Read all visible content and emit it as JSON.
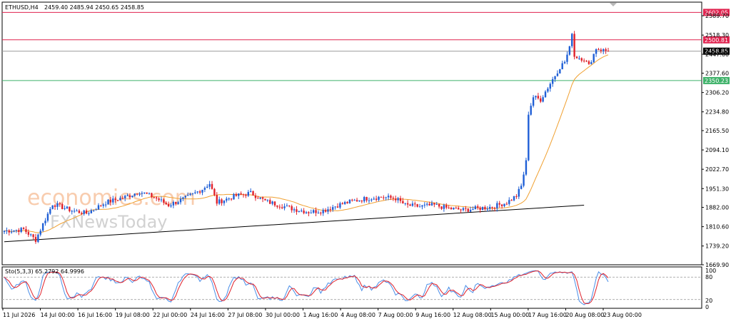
{
  "header": {
    "symbol": "ETHUSD,H4",
    "ohlc": "2459.40 2485.94 2450.65 2458.85"
  },
  "oscillator": {
    "label": "Sto(5,3,3) 65.2792 64.9996",
    "k": 65.2792,
    "d": 64.9996,
    "levels": [
      "100",
      "80",
      "20",
      "0"
    ]
  },
  "watermark": {
    "brand": "economies.com",
    "sub": "FXNewsToday"
  },
  "colors": {
    "bull": "#1f5fd6",
    "bear": "#e0212b",
    "ma": "#f0a030",
    "trend": "#000000",
    "resistance": "#e0234f",
    "support": "#3fb26a",
    "stoch_k": "#4a8ee8",
    "stoch_d": "#e0212b"
  },
  "chart_data": {
    "type": "candlestick",
    "ylim": [
      1669.9,
      2640.0
    ],
    "y_ticks": [
      "2589.70",
      "2518.30",
      "2447.60",
      "2377.60",
      "2306.20",
      "2234.80",
      "2165.50",
      "2094.10",
      "2022.70",
      "1951.30",
      "1882.00",
      "1810.60",
      "1739.20",
      "1669.90"
    ],
    "x_ticks": [
      "11 Jul 2026",
      "14 Jul 00:00",
      "16 Jul 16:00",
      "19 Jul 08:00",
      "22 Jul 00:00",
      "24 Jul 16:00",
      "27 Jul 08:00",
      "30 Jul 00:00",
      "1 Aug 16:00",
      "4 Aug 08:00",
      "7 Aug 00:00",
      "9 Aug 16:00",
      "12 Aug 08:00",
      "15 Aug 00:00",
      "17 Aug 16:00",
      "20 Aug 08:00",
      "23 Aug 00:00"
    ],
    "levels": [
      {
        "value": 2602.05,
        "label": "2602.05",
        "kind": "resistance"
      },
      {
        "value": 2500.81,
        "label": "2500.81",
        "kind": "resistance"
      },
      {
        "value": 2458.85,
        "label": "2458.85",
        "kind": "current"
      },
      {
        "value": 2350.23,
        "label": "2350.23",
        "kind": "support"
      }
    ],
    "anchors": [
      [
        0,
        1795
      ],
      [
        8,
        1800
      ],
      [
        13,
        1762
      ],
      [
        16,
        1820
      ],
      [
        20,
        1895
      ],
      [
        28,
        1870
      ],
      [
        34,
        1860
      ],
      [
        42,
        1900
      ],
      [
        50,
        1920
      ],
      [
        56,
        1940
      ],
      [
        62,
        1920
      ],
      [
        68,
        1890
      ],
      [
        76,
        1920
      ],
      [
        82,
        1950
      ],
      [
        85,
        1970
      ],
      [
        88,
        1900
      ],
      [
        96,
        1925
      ],
      [
        102,
        1935
      ],
      [
        108,
        1905
      ],
      [
        114,
        1890
      ],
      [
        120,
        1875
      ],
      [
        126,
        1865
      ],
      [
        132,
        1870
      ],
      [
        138,
        1890
      ],
      [
        144,
        1905
      ],
      [
        150,
        1915
      ],
      [
        156,
        1920
      ],
      [
        162,
        1915
      ],
      [
        166,
        1890
      ],
      [
        172,
        1885
      ],
      [
        178,
        1890
      ],
      [
        184,
        1878
      ],
      [
        190,
        1872
      ],
      [
        196,
        1878
      ],
      [
        202,
        1884
      ],
      [
        208,
        1900
      ],
      [
        212,
        1925
      ],
      [
        214,
        1960
      ],
      [
        216,
        2050
      ],
      [
        217,
        2230
      ],
      [
        219,
        2290
      ],
      [
        222,
        2280
      ],
      [
        226,
        2340
      ],
      [
        230,
        2400
      ],
      [
        232,
        2420
      ],
      [
        234,
        2470
      ],
      [
        235,
        2530
      ],
      [
        236,
        2440
      ],
      [
        240,
        2430
      ],
      [
        242,
        2405
      ],
      [
        245,
        2470
      ],
      [
        248,
        2462
      ],
      [
        250,
        2458.85
      ]
    ],
    "ma_period": 20,
    "trendline": {
      "from": [
        0,
        1755
      ],
      "to": [
        240,
        1890
      ]
    },
    "n_candles": 251
  }
}
